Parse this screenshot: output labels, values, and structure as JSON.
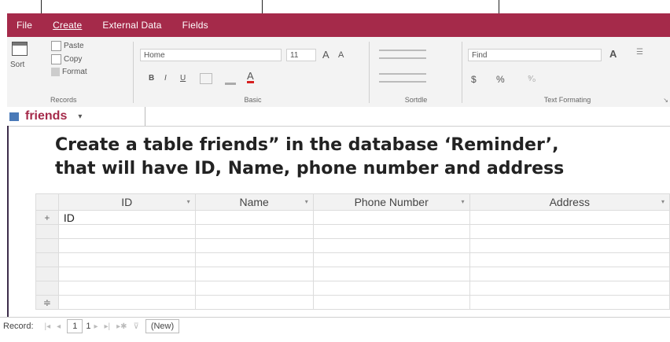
{
  "ribbon_tabs": [
    {
      "label": "File",
      "active": false
    },
    {
      "label": "Create",
      "active": true
    },
    {
      "label": "External Data",
      "active": false
    },
    {
      "label": "Fields",
      "active": false
    }
  ],
  "ribbon": {
    "records": {
      "sort_label": "Sort",
      "paste_label": "Paste",
      "copy_label": "Copy",
      "format_label": "Format",
      "group_label": "Records"
    },
    "basic": {
      "font_value": "Home",
      "size_value": "11",
      "group_label": "Basic",
      "grow_font": "A",
      "shrink_font": "A",
      "bold": "B",
      "italic": "I",
      "underline": "U"
    },
    "sort_group_label": "Sortdle",
    "text_formatting": {
      "find_value": "Find",
      "group_label": "Text Formating",
      "currency": "$",
      "percent": "%"
    }
  },
  "doc_tab": {
    "name": "friends"
  },
  "caption": {
    "line1": "Create a table friends” in the database ‘Reminder’,",
    "line2": "that will have ID, Name, phone number and address"
  },
  "table": {
    "columns": [
      "ID",
      "Name",
      "Phone Number",
      "Address"
    ],
    "first_row_id": "ID"
  },
  "status": {
    "record_label": "Record:",
    "current": "1",
    "total": "1",
    "new_label": "(New)"
  }
}
